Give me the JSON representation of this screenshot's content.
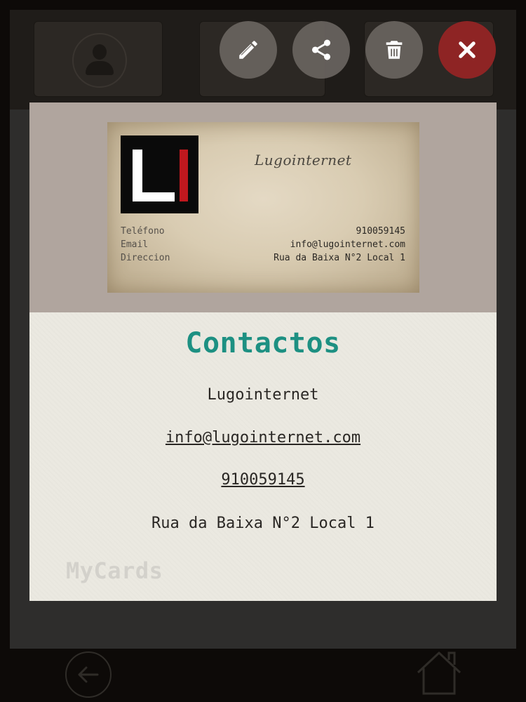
{
  "actions": {
    "edit_icon": "pencil-icon",
    "share_icon": "share-icon",
    "delete_icon": "trash-icon",
    "close_icon": "close-icon"
  },
  "business_card": {
    "company": "Lugointernet",
    "logo_text": "LI",
    "labels": [
      "Teléfono",
      "Email",
      "Direccion"
    ],
    "values": [
      "910059145",
      "info@lugointernet.com",
      "Rua da Baixa N°2 Local 1"
    ]
  },
  "contact": {
    "title": "Contactos",
    "name": "Lugointernet",
    "email": "info@lugointernet.com",
    "phone": "910059145",
    "address": "Rua da Baixa N°2 Local 1"
  },
  "watermark": "MyCards",
  "nav": {
    "back_icon": "back-arrow-icon",
    "home_icon": "home-icon"
  },
  "colors": {
    "accent_teal": "#1d9082",
    "close_red": "#8e2424",
    "logo_red": "#c0181e"
  }
}
